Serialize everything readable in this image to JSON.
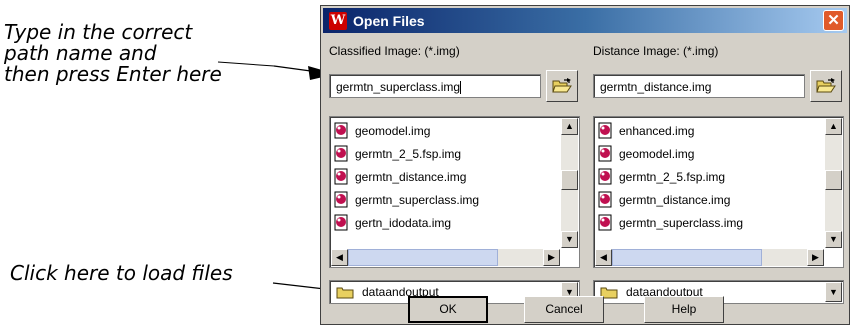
{
  "callouts": {
    "top": [
      "Type in the correct",
      "path name and",
      "then press Enter here"
    ],
    "bottom": "Click here to load files"
  },
  "dialog": {
    "title": "Open Files",
    "close_glyph": "✕",
    "left": {
      "label": "Classified Image: (*.img)",
      "path_value": "germtn_superclass.img",
      "files": [
        "geomodel.img",
        "germtn_2_5.fsp.img",
        "germtn_distance.img",
        "germtn_superclass.img",
        "gertn_idodata.img"
      ],
      "directory": "dataandoutput"
    },
    "right": {
      "label": "Distance Image: (*.img)",
      "path_value": "germtn_distance.img",
      "files": [
        "enhanced.img",
        "geomodel.img",
        "germtn_2_5.fsp.img",
        "germtn_distance.img",
        "germtn_superclass.img"
      ],
      "directory": "dataandoutput"
    },
    "buttons": {
      "ok": "OK",
      "cancel": "Cancel",
      "help": "Help"
    }
  },
  "colors": {
    "titlebar": "#0a246a",
    "close": "#e05a2a",
    "face": "#d4d0c8"
  },
  "icons": {
    "app": "app-logo-icon",
    "folder_open": "folder-open-icon",
    "file": "image-file-icon"
  }
}
